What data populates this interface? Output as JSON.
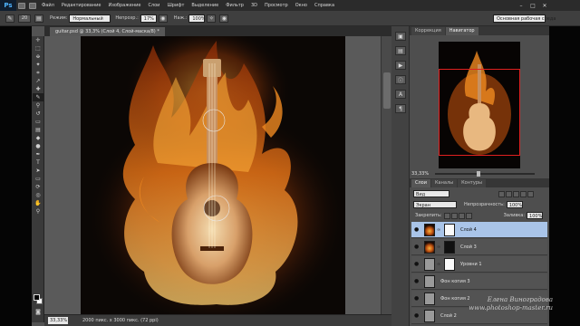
{
  "app": {
    "logo": "Ps",
    "menus": [
      "Файл",
      "Редактирование",
      "Изображение",
      "Слои",
      "Шрифт",
      "Выделение",
      "Фильтр",
      "3D",
      "Просмотр",
      "Окно",
      "Справка"
    ]
  },
  "options": {
    "mode_label": "Режим:",
    "mode_value": "Нормальный",
    "opacity_label": "Непрозр.:",
    "opacity_value": "17%",
    "flow_label": "Наж.:",
    "flow_value": "100%",
    "brush_size": "20",
    "workspace": "Основная рабочая среда"
  },
  "document": {
    "tab_title": "guitar.psd @ 33,3% (Слой 4, Слой-маска/8) *",
    "zoom": "33,33%",
    "info": "2000 пикс. x 3000 пикс. (72 ppi)"
  },
  "navigator": {
    "tabs": [
      "Коррекция",
      "Навигатор"
    ],
    "active_tab": "Навигатор",
    "zoom": "33,33%"
  },
  "layers": {
    "tabs": [
      "Слои",
      "Каналы",
      "Контуры"
    ],
    "active_tab": "Слои",
    "kind": "Вид",
    "blend": "Экран",
    "opacity_label": "Непрозрачность:",
    "opacity": "100%",
    "lock_label": "Закрепить:",
    "fill_label": "Заливка:",
    "fill": "100%",
    "items": [
      {
        "name": "Слой 4",
        "selected": true
      },
      {
        "name": "Слой 3",
        "selected": false
      },
      {
        "name": "Уровни 1",
        "selected": false
      },
      {
        "name": "Фон копия 3",
        "selected": false
      },
      {
        "name": "Фон копия 2",
        "selected": false
      },
      {
        "name": "Слой 2",
        "selected": false
      }
    ]
  },
  "watermark": {
    "line1": "Елена Виноградова",
    "line2": "www.photoshop-master.ru"
  },
  "colors": {
    "accent": "#a9c4e8",
    "navigator_frame": "#e02020",
    "fire_core": "#f5b540",
    "fire_outer": "#c25210"
  },
  "icons": [
    "brush-tool-icon",
    "eye-icon",
    "link-icon",
    "minimize-icon",
    "maximize-icon",
    "close-icon"
  ]
}
